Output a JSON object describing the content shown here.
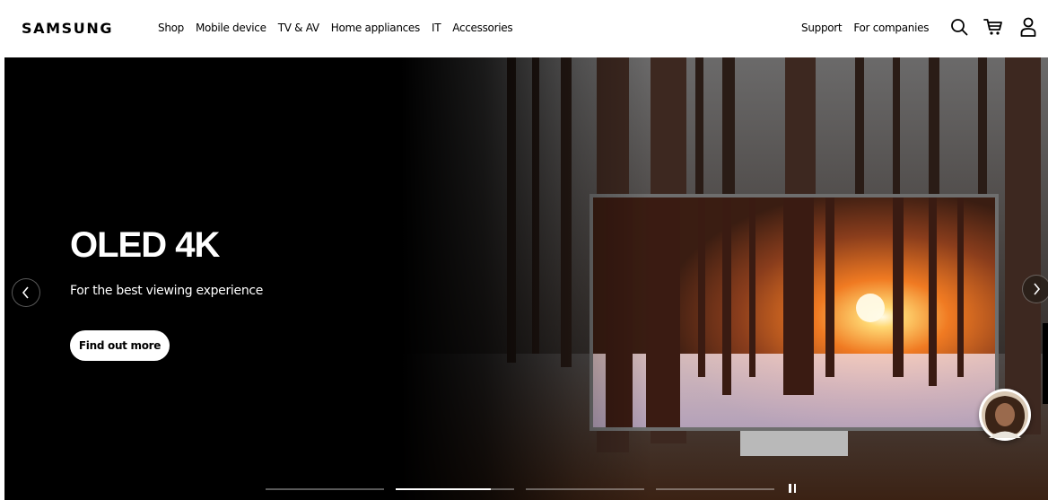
{
  "header": {
    "logo": "SAMSUNG",
    "nav": [
      "Shop",
      "Mobile device",
      "TV & AV",
      "Home appliances",
      "IT",
      "Accessories"
    ],
    "utility": [
      "Support",
      "For companies"
    ],
    "icons": [
      "search-icon",
      "cart-icon",
      "user-icon"
    ]
  },
  "hero": {
    "title": "OLED 4K",
    "subtitle": "For the best viewing experience",
    "cta": "Find out more",
    "slides": [
      {
        "progress": 0
      },
      {
        "progress": 0.8
      },
      {
        "progress": 0
      },
      {
        "progress": 0
      }
    ],
    "active_slide": 2
  },
  "colors": {
    "header_bg": "#ffffff",
    "hero_bg": "#000000",
    "accent_text": "#ffffff"
  }
}
